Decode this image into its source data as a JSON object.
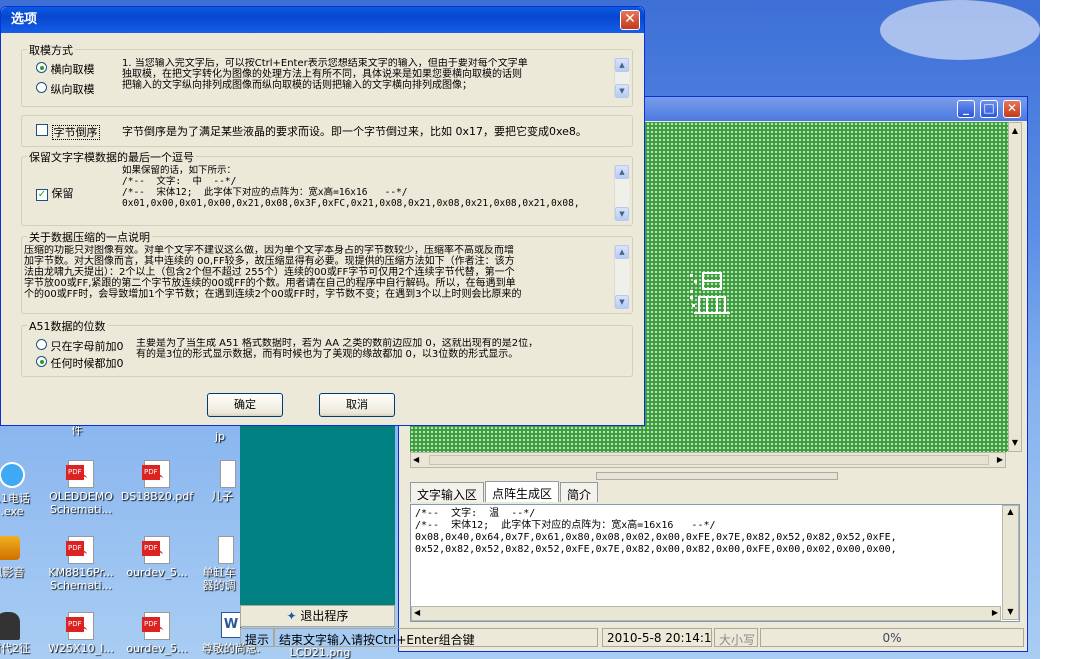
{
  "desktop": {
    "icons": [
      {
        "label": "件",
        "row": 0
      },
      {
        "label": "jp",
        "row": 0
      },
      {
        "label": "11电话\n.exe",
        "icon": "phone"
      },
      {
        "label": "OLEDDEMO\nSchemati...",
        "icon": "pdf"
      },
      {
        "label": "DS18B20.pdf",
        "icon": "pdf"
      },
      {
        "label": "儿子",
        "icon": "doc"
      },
      {
        "label": "风影音",
        "icon": "app"
      },
      {
        "label": "KM8816Pr...\nSchemati...",
        "icon": "pdf"
      },
      {
        "label": "ourdev_5...",
        "icon": "pdf"
      },
      {
        "label": "单缸车\n器的调",
        "icon": "doc"
      },
      {
        "label": "时代2征",
        "icon": "app"
      },
      {
        "label": "W25X10_I...",
        "icon": "pdf"
      },
      {
        "label": "ourdev_5...",
        "icon": "pdf"
      },
      {
        "label": "尊敬的尚总.",
        "icon": "word"
      },
      {
        "label": "LCD21.png",
        "icon": "img"
      }
    ]
  },
  "app": {
    "tabs": [
      "文字输入区",
      "点阵生成区",
      "简介"
    ],
    "active_tab": "点阵生成区",
    "output_text": "/*--  文字:  温  --*/\n/*--  宋体12;  此字体下对应的点阵为：宽x高=16x16   --*/\n0x08,0x40,0x64,0x7F,0x61,0x80,0x08,0x02,0x00,0xFE,0x7E,0x82,0x52,0x82,0x52,0xFE,\n0x52,0x82,0x52,0x82,0x52,0xFE,0x7E,0x82,0x00,0x82,0x00,0xFE,0x00,0x02,0x00,0x00,",
    "exit_label": "退出程序",
    "status": {
      "hint_label": "提示",
      "hint_text": "结束文字输入请按Ctrl+Enter组合键",
      "datetime": "2010-5-8 20:14:14",
      "caps": "大小写",
      "progress": "0%"
    }
  },
  "dialog": {
    "title": "选项",
    "group_mode": {
      "title": "取模方式",
      "opt_horizontal": "横向取模",
      "opt_vertical": "纵向取模",
      "selected": "横向取模",
      "desc": "1. 当您输入完文字后，可以按Ctrl+Enter表示您想结束文字的输入，但由于要对每个文字单\n独取模，在把文字转化为图像的处理方法上有所不同，具体说来是如果您要横向取模的话则\n把输入的文字纵向排列成图像而纵向取模的话则把输入的文字横向排列成图像；"
    },
    "byte_order": {
      "label": "字节倒序",
      "checked": false,
      "desc": "字节倒序是为了满足某些液晶的要求而设。即一个字节倒过来，比如 0x17，要把它变成0xe8。"
    },
    "group_comma": {
      "title": "保留文字字模数据的最后一个逗号",
      "label": "保留",
      "checked": true,
      "desc": "如果保留的话，如下所示：\n/*--  文字:  中  --*/\n/*--  宋体12;  此字体下对应的点阵为：宽x高=16x16   --*/\n0x01,0x00,0x01,0x00,0x21,0x08,0x3F,0xFC,0x21,0x08,0x21,0x08,0x21,0x08,0x21,0x08,"
    },
    "group_compress": {
      "title": "关于数据压缩的一点说明",
      "desc": "压缩的功能只对图像有效。对单个文字不建议这么做，因为单个文字本身占的字节数较少，压缩率不高或反而增\n加字节数。对大图像而言，其中连续的 00,FF较多，故压缩显得有必要。现提供的压缩方法如下（作者注：该方\n法由龙啸九天提出）：2个以上（包含2个但不超过 255个）连续的00或FF字节可仅用2个连续字节代替，第一个\n字节放00或FF,紧跟的第二个字节放连续的00或FF的个数。用者请在自己的程序中自行解码。所以，在每遇到单\n个的00或FF时，会导致增加1个字节数；在遇到连续2个00或FF时，字节数不变；在遇到3个以上时则会比原来的"
    },
    "group_a51": {
      "title": "A51数据的位数",
      "opt_alpha": "只在字母前加0",
      "opt_any": "任何时候都加0",
      "selected": "任何时候都加0",
      "desc": "主要是为了当生成 A51 格式数据时，若为 AA 之类的数前边应加 0，这就出现有的是2位，\n有的是3位的形式显示数据，而有时候也为了美观的缘故都加 0，以3位数的形式显示。"
    },
    "ok_label": "确定",
    "cancel_label": "取消"
  }
}
